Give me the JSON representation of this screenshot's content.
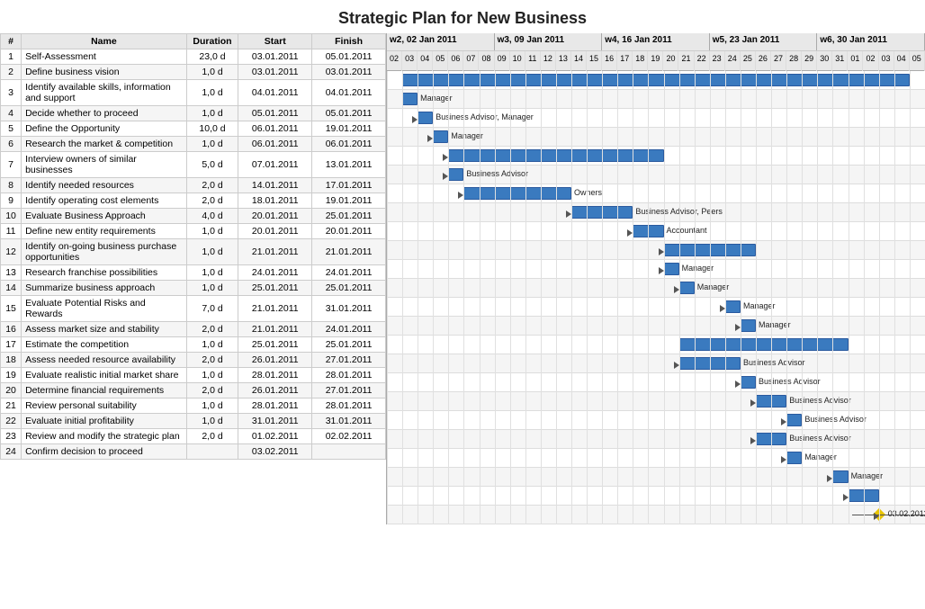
{
  "title": "Strategic Plan for New Business",
  "table": {
    "headers": [
      "#",
      "Name",
      "Duration",
      "Start",
      "Finish"
    ],
    "rows": [
      {
        "num": "1",
        "name": "Self-Assessment",
        "dur": "23,0 d",
        "start": "03.01.2011",
        "finish": "05.01.2011"
      },
      {
        "num": "2",
        "name": "Define business vision",
        "dur": "1,0 d",
        "start": "03.01.2011",
        "finish": "03.01.2011"
      },
      {
        "num": "3",
        "name": "Identify available skills, information and support",
        "dur": "1,0 d",
        "start": "04.01.2011",
        "finish": "04.01.2011"
      },
      {
        "num": "4",
        "name": "Decide whether to proceed",
        "dur": "1,0 d",
        "start": "05.01.2011",
        "finish": "05.01.2011"
      },
      {
        "num": "5",
        "name": "Define the Opportunity",
        "dur": "10,0 d",
        "start": "06.01.2011",
        "finish": "19.01.2011"
      },
      {
        "num": "6",
        "name": "Research the market & competition",
        "dur": "1,0 d",
        "start": "06.01.2011",
        "finish": "06.01.2011"
      },
      {
        "num": "7",
        "name": "Interview owners of similar businesses",
        "dur": "5,0 d",
        "start": "07.01.2011",
        "finish": "13.01.2011"
      },
      {
        "num": "8",
        "name": "Identify needed resources",
        "dur": "2,0 d",
        "start": "14.01.2011",
        "finish": "17.01.2011"
      },
      {
        "num": "9",
        "name": "Identify operating cost elements",
        "dur": "2,0 d",
        "start": "18.01.2011",
        "finish": "19.01.2011"
      },
      {
        "num": "10",
        "name": "Evaluate Business Approach",
        "dur": "4,0 d",
        "start": "20.01.2011",
        "finish": "25.01.2011"
      },
      {
        "num": "11",
        "name": "Define new entity requirements",
        "dur": "1,0 d",
        "start": "20.01.2011",
        "finish": "20.01.2011"
      },
      {
        "num": "12",
        "name": "Identify on-going business purchase opportunities",
        "dur": "1,0 d",
        "start": "21.01.2011",
        "finish": "21.01.2011"
      },
      {
        "num": "13",
        "name": "Research franchise possibilities",
        "dur": "1,0 d",
        "start": "24.01.2011",
        "finish": "24.01.2011"
      },
      {
        "num": "14",
        "name": "Summarize business approach",
        "dur": "1,0 d",
        "start": "25.01.2011",
        "finish": "25.01.2011"
      },
      {
        "num": "15",
        "name": "Evaluate Potential Risks and Rewards",
        "dur": "7,0 d",
        "start": "21.01.2011",
        "finish": "31.01.2011"
      },
      {
        "num": "16",
        "name": "Assess market size and stability",
        "dur": "2,0 d",
        "start": "21.01.2011",
        "finish": "24.01.2011"
      },
      {
        "num": "17",
        "name": "Estimate the competition",
        "dur": "1,0 d",
        "start": "25.01.2011",
        "finish": "25.01.2011"
      },
      {
        "num": "18",
        "name": "Assess needed resource availability",
        "dur": "2,0 d",
        "start": "26.01.2011",
        "finish": "27.01.2011"
      },
      {
        "num": "19",
        "name": "Evaluate realistic initial market share",
        "dur": "1,0 d",
        "start": "28.01.2011",
        "finish": "28.01.2011"
      },
      {
        "num": "20",
        "name": "Determine financial requirements",
        "dur": "2,0 d",
        "start": "26.01.2011",
        "finish": "27.01.2011"
      },
      {
        "num": "21",
        "name": "Review personal suitability",
        "dur": "1,0 d",
        "start": "28.01.2011",
        "finish": "28.01.2011"
      },
      {
        "num": "22",
        "name": "Evaluate initial profitability",
        "dur": "1,0 d",
        "start": "31.01.2011",
        "finish": "31.01.2011"
      },
      {
        "num": "23",
        "name": "Review and modify the strategic plan",
        "dur": "2,0 d",
        "start": "01.02.2011",
        "finish": "02.02.2011"
      },
      {
        "num": "24",
        "name": "Confirm decision to proceed",
        "dur": "",
        "start": "03.02.2011",
        "finish": ""
      }
    ]
  },
  "gantt": {
    "weeks": [
      {
        "label": "w2, 02 Jan 2011",
        "days": [
          "02",
          "03",
          "04",
          "05",
          "06",
          "07",
          "08"
        ]
      },
      {
        "label": "w3, 09 Jan 2011",
        "days": [
          "09",
          "10",
          "11",
          "12",
          "13",
          "14",
          "15"
        ]
      },
      {
        "label": "w4, 16 Jan 2011",
        "days": [
          "16",
          "17",
          "18",
          "19",
          "20",
          "21",
          "22"
        ]
      },
      {
        "label": "w5, 23 Jan 2011",
        "days": [
          "23",
          "24",
          "25",
          "26",
          "27",
          "28",
          "29"
        ]
      },
      {
        "label": "w6, 30 Jan 2011",
        "days": [
          "30",
          "31",
          "01",
          "02",
          "03",
          "04",
          "05"
        ]
      }
    ]
  }
}
